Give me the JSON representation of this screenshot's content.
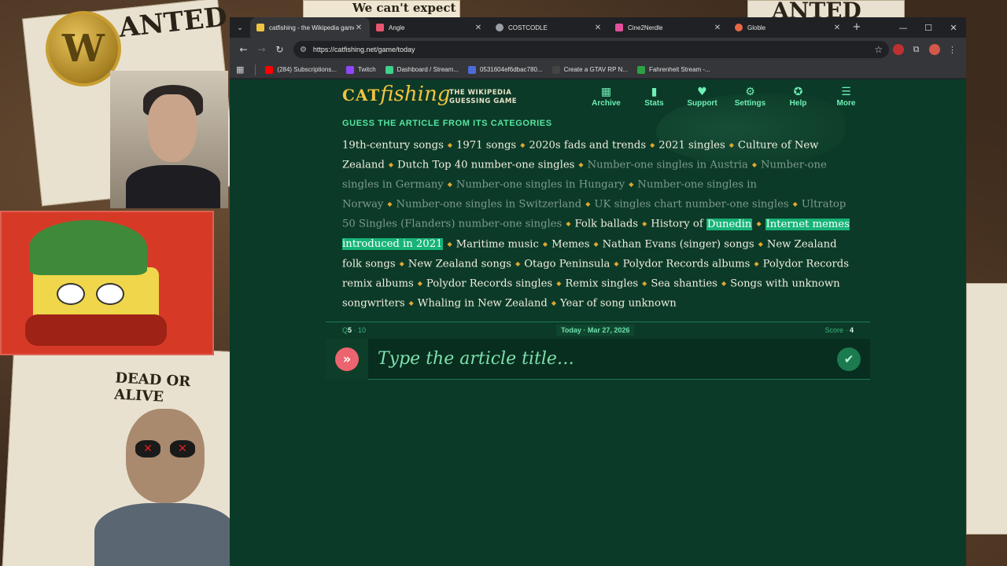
{
  "browser": {
    "tabs": [
      {
        "title": "catfishing - the Wikipedia game",
        "favicon_color": "#f0c441",
        "active": true
      },
      {
        "title": "Angle",
        "favicon_color": "#e9556e",
        "active": false
      },
      {
        "title": "COSTCODLE",
        "favicon_color": "#9aa0a6",
        "active": false
      },
      {
        "title": "Cine2Nerdle",
        "favicon_color": "#e34f9a",
        "active": false
      },
      {
        "title": "Globle",
        "favicon_color": "#e66845",
        "active": false
      }
    ],
    "url": "https://catfishing.net/game/today",
    "bookmarks": [
      {
        "label": "(284) Subscriptions...",
        "icon_color": "#ff0000"
      },
      {
        "label": "Twitch",
        "icon_color": "#9146ff"
      },
      {
        "label": "Dashboard / Stream...",
        "icon_color": "#3fcf8e"
      },
      {
        "label": "0531604ef6dbac780...",
        "icon_color": "#4f6bd6"
      },
      {
        "label": "Create a GTAV RP N...",
        "icon_color": "#222222"
      },
      {
        "label": "Fahrenheit Stream -...",
        "icon_color": "#2ea043"
      }
    ],
    "extension_badge": "2"
  },
  "game": {
    "brand_cat": "CAT",
    "brand_fishing": "fishing",
    "tagline_1": "THE WIKIPEDIA",
    "tagline_2": "GUESSING GAME",
    "menu": [
      {
        "label": "Archive",
        "icon": "calendar-icon"
      },
      {
        "label": "Stats",
        "icon": "bar-chart-icon"
      },
      {
        "label": "Support",
        "icon": "heart-icon"
      },
      {
        "label": "Settings",
        "icon": "gear-icon"
      },
      {
        "label": "Help",
        "icon": "help-icon"
      },
      {
        "label": "More",
        "icon": "hamburger-icon"
      }
    ],
    "subtitle": "GUESS THE ARTICLE FROM ITS CATEGORIES",
    "categories": [
      {
        "text": "19th-century songs",
        "dim": false
      },
      {
        "text": "1971 songs",
        "dim": false
      },
      {
        "text": "2020s fads and trends",
        "dim": false
      },
      {
        "text": "2021 singles",
        "dim": false
      },
      {
        "text": "Culture of New Zealand",
        "dim": false
      },
      {
        "text": "Dutch Top 40 number-one singles",
        "dim": false
      },
      {
        "text": "Number-one singles in Austria",
        "dim": true
      },
      {
        "text": "Number-one singles in Germany",
        "dim": true
      },
      {
        "text": "Number-one singles in Hungary",
        "dim": true
      },
      {
        "text": "Number-one singles in Norway",
        "dim": true
      },
      {
        "text": "Number-one singles in Switzerland",
        "dim": true
      },
      {
        "text": "UK singles chart number-one singles",
        "dim": true
      },
      {
        "text": "Ultratop 50 Singles (Flanders) number-one singles",
        "dim": true
      },
      {
        "text": "Folk ballads",
        "dim": false
      },
      {
        "text": "History of ",
        "dim": false,
        "highlight": "Dunedin"
      },
      {
        "text": "",
        "dim": false,
        "highlight": "Internet memes introduced in 2021"
      },
      {
        "text": "Maritime music",
        "dim": false
      },
      {
        "text": "Memes",
        "dim": false
      },
      {
        "text": "Nathan Evans (singer) songs",
        "dim": false
      },
      {
        "text": "New Zealand folk songs",
        "dim": false
      },
      {
        "text": "New Zealand songs",
        "dim": false
      },
      {
        "text": "Otago Peninsula",
        "dim": false
      },
      {
        "text": "Polydor Records albums",
        "dim": false
      },
      {
        "text": "Polydor Records remix albums",
        "dim": false
      },
      {
        "text": "Polydor Records singles",
        "dim": false
      },
      {
        "text": "Remix singles",
        "dim": false
      },
      {
        "text": "Sea shanties",
        "dim": false
      },
      {
        "text": "Songs with unknown songwriters",
        "dim": false
      },
      {
        "text": "Whaling in New Zealand",
        "dim": false
      },
      {
        "text": "Year of song unknown",
        "dim": false
      }
    ],
    "guess_prefix": "Q",
    "guess_current": "5",
    "guess_sep": " · ",
    "guess_total": "10",
    "today_label": "Today · Mar 27, 2026",
    "score_label": "Score · ",
    "score_value": "4",
    "input_placeholder": "Type the article title…"
  },
  "overlay": {
    "poster_text_1": "ANTED",
    "poster_text_2": "We can't expect",
    "poster_text_3": "ANTED",
    "poster_text_4": "DEAD OR ALIVE",
    "logo_letter": "W"
  },
  "colors": {
    "page_bg": "#0c3a28",
    "accent_green": "#6ef0b6",
    "brand_yellow": "#f0c441",
    "highlight": "#17b377",
    "skip_red": "#ec6470"
  }
}
